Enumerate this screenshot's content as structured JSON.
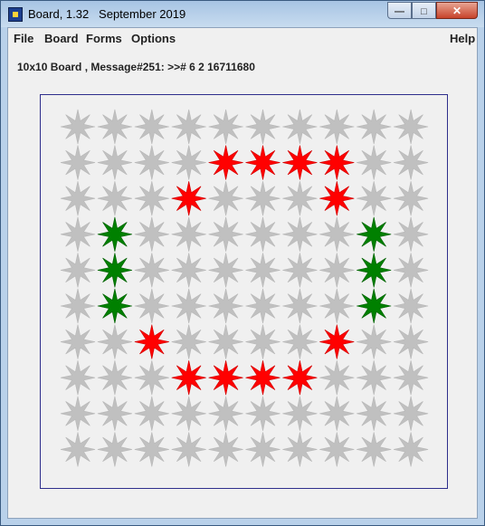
{
  "window": {
    "title": "Board, 1.32   September 2019"
  },
  "menu": {
    "file": "File",
    "board": "Board",
    "forms": "Forms",
    "options": "Options",
    "help": "Help"
  },
  "status": {
    "text": "10x10 Board , Message#251: >># 6 2 16711680"
  },
  "colors": {
    "gray": "#c0c0c0",
    "red": "#ff0000",
    "green": "#008000",
    "border": "#2e2e8c"
  },
  "board": {
    "rows": 10,
    "cols": 10,
    "cells": [
      "gggggggggg",
      "ggggrrrrgg",
      "gggrgggrgg",
      "gGggggggGg",
      "gGggggggGg",
      "gGggggggGg",
      "ggrggggrgg",
      "gggrrrrggg",
      "gggggggggg",
      "gggggggggg"
    ],
    "legend": {
      "g": "gray",
      "r": "red",
      "G": "green"
    }
  }
}
